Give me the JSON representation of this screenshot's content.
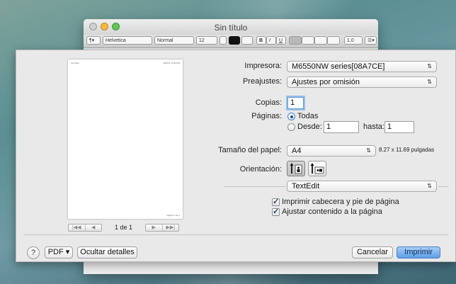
{
  "window": {
    "title": "Sin título",
    "toolbar": {
      "paragraph_btn": "¶▾",
      "font": "Helvetica",
      "style": "Normal",
      "size": "12",
      "bold": "B",
      "italic": "I",
      "underline": "U",
      "spacing": "1.0",
      "list": "☰▾"
    }
  },
  "preview": {
    "header_left": "Sin título",
    "header_right": "2/10/14 12:00 PM",
    "footer": "Página 1 de 1",
    "page_count": "1 de 1",
    "pager_first": "|◀◀",
    "pager_prev": "◀",
    "pager_next": "▶",
    "pager_last": "▶▶|"
  },
  "form": {
    "printer_label": "Impresora:",
    "printer_value": "M6550NW series[08A7CE]",
    "presets_label": "Preajustes:",
    "presets_value": "Ajustes por omisión",
    "copies_label": "Copias:",
    "copies_value": "1",
    "pages_label": "Páginas:",
    "pages_all": "Todas",
    "pages_from": "Desde:",
    "pages_from_value": "1",
    "pages_to": "hasta:",
    "pages_to_value": "1",
    "paper_label": "Tamaño del papel:",
    "paper_value": "A4",
    "paper_dims": "8.27 x 11.69 pulgadas",
    "orientation_label": "Orientación:",
    "section_popup": "TextEdit",
    "check_header": "Imprimir cabecera y pie de página",
    "check_fit": "Ajustar contenido a la página"
  },
  "footer": {
    "help": "?",
    "pdf": "PDF ▾",
    "hide_details": "Ocultar detalles",
    "cancel": "Cancelar",
    "print": "Imprimir"
  },
  "icons": {
    "popup_arrows": "⇅",
    "checkmark": "✓",
    "portrait": "portrait-orientation-icon",
    "landscape": "landscape-orientation-icon"
  }
}
